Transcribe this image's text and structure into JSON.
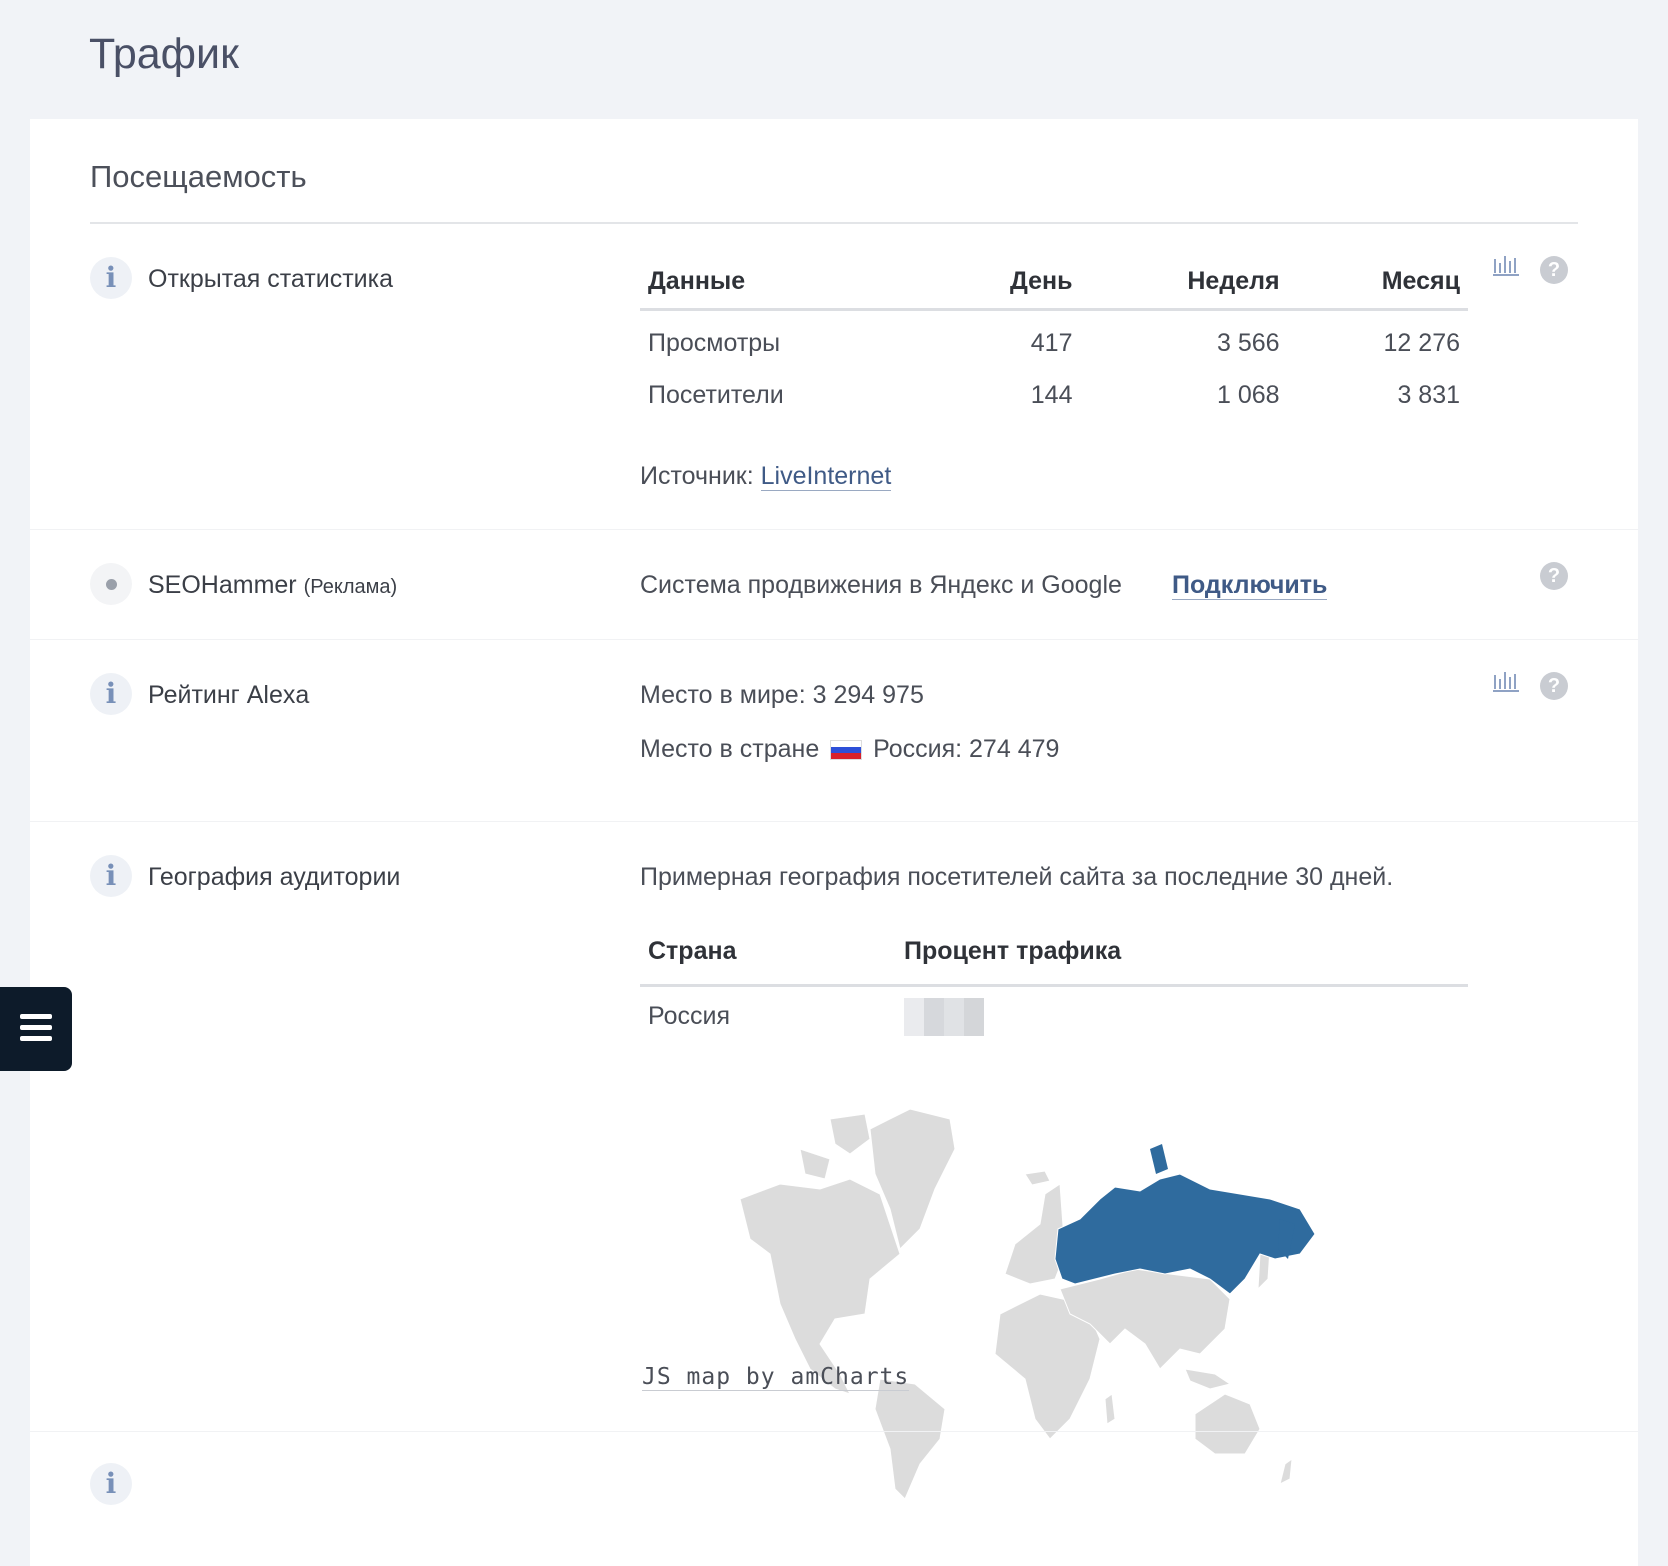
{
  "page": {
    "title": "Трафик"
  },
  "card": {
    "title": "Посещаемость"
  },
  "open_stats": {
    "label": "Открытая статистика",
    "headers": [
      "Данные",
      "День",
      "Неделя",
      "Месяц"
    ],
    "rows": [
      {
        "name": "Просмотры",
        "day": "417",
        "week": "3 566",
        "month": "12 276"
      },
      {
        "name": "Посетители",
        "day": "144",
        "week": "1 068",
        "month": "3 831"
      }
    ],
    "source_label": "Источник:",
    "source_link": "LiveInternet"
  },
  "seohammer": {
    "label": "SEOHammer",
    "ad": "(Реклама)",
    "description": "Система продвижения в Яндекс и Google",
    "connect": "Подключить"
  },
  "alexa": {
    "label": "Рейтинг Alexa",
    "world_label": "Место в мире:",
    "world_value": "3 294 975",
    "country_label": "Место в стране",
    "country_name": "Россия:",
    "country_value": "274 479"
  },
  "geography": {
    "label": "География аудитории",
    "description": "Примерная география посетителей сайта за последние 30 дней.",
    "headers": [
      "Страна",
      "Процент трафика"
    ],
    "rows": [
      {
        "country": "Россия"
      }
    ],
    "map_credit": "JS map by amCharts",
    "highlight_color": "#2f6b9e",
    "land_color": "#dcdcdc"
  },
  "icons": {
    "info": "i",
    "help": "?"
  }
}
